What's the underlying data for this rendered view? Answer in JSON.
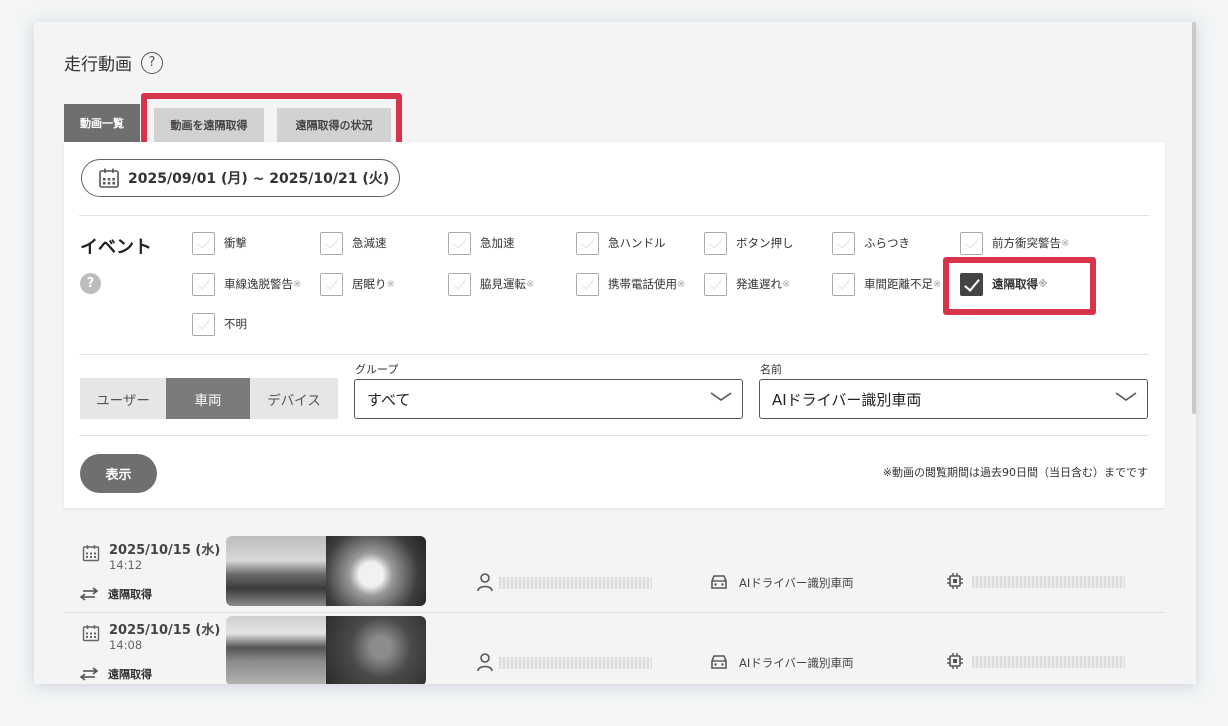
{
  "page": {
    "title": "走行動画"
  },
  "tabs": [
    {
      "label": "動画一覧",
      "active": true
    },
    {
      "label": "動画を遠隔取得",
      "active": false
    },
    {
      "label": "遠隔取得の状況",
      "active": false
    }
  ],
  "filters": {
    "date_range": "2025/09/01 (月) ~ 2025/10/21 (火)",
    "event_label": "イベント",
    "events": [
      {
        "label": "衝撃",
        "note": "",
        "checked": false
      },
      {
        "label": "急減速",
        "note": "",
        "checked": false
      },
      {
        "label": "急加速",
        "note": "",
        "checked": false
      },
      {
        "label": "急ハンドル",
        "note": "",
        "checked": false
      },
      {
        "label": "ボタン押し",
        "note": "",
        "checked": false
      },
      {
        "label": "ふらつき",
        "note": "",
        "checked": false
      },
      {
        "label": "前方衝突警告",
        "note": "※",
        "checked": false
      },
      {
        "label": "車線逸脱警告",
        "note": "※",
        "checked": false
      },
      {
        "label": "居眠り",
        "note": "※",
        "checked": false
      },
      {
        "label": "脇見運転",
        "note": "※",
        "checked": false
      },
      {
        "label": "携帯電話使用",
        "note": "※",
        "checked": false
      },
      {
        "label": "発進遅れ",
        "note": "※",
        "checked": false
      },
      {
        "label": "車間距離不足",
        "note": "※",
        "checked": false
      },
      {
        "label": "遠隔取得",
        "note": "※",
        "checked": true
      },
      {
        "label": "不明",
        "note": "",
        "checked": false
      }
    ],
    "segment": [
      {
        "label": "ユーザー",
        "active": false
      },
      {
        "label": "車両",
        "active": true
      },
      {
        "label": "デバイス",
        "active": false
      }
    ],
    "group": {
      "label": "グループ",
      "value": "すべて"
    },
    "name": {
      "label": "名前",
      "value": "AIドライバー識別車両"
    },
    "submit_label": "表示",
    "footnote": "※動画の閲覧期間は過去90日間（当日含む）までです"
  },
  "results": [
    {
      "date": "2025/10/15 (水)",
      "time": "14:12",
      "type": "遠隔取得",
      "vehicle": "AIドライバー識別車両"
    },
    {
      "date": "2025/10/15 (水)",
      "time": "14:08",
      "type": "遠隔取得",
      "vehicle": "AIドライバー識別車両"
    }
  ],
  "colors": {
    "highlight": "#d9334a",
    "active": "#6f6f6f",
    "tab_inactive": "#d2d2d2"
  }
}
